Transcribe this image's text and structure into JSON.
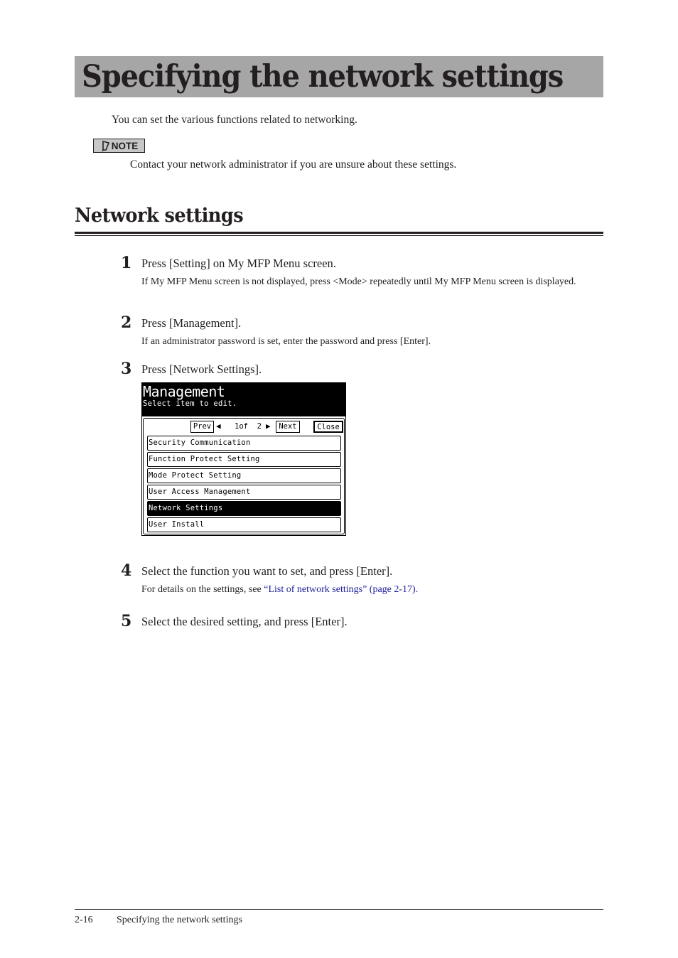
{
  "page_title": "Specifying the network settings",
  "intro": "You can set the various functions related to networking.",
  "note": {
    "icon": "pencil-icon",
    "label": "NOTE",
    "text": "Contact your network administrator if you are unsure about these settings."
  },
  "section": {
    "heading": "Network settings"
  },
  "steps": [
    {
      "number": "1",
      "text": "Press [Setting] on My MFP Menu screen.",
      "sub": "If My MFP Menu screen is not displayed, press <Mode> repeatedly until My MFP Menu screen is displayed."
    },
    {
      "number": "2",
      "text": "Press [Management].",
      "sub": "If an administrator password is set, enter the password and press [Enter]."
    },
    {
      "number": "3",
      "text": "Press [Network Settings]."
    },
    {
      "number": "4",
      "text": "Select the function you want to set, and press [Enter].",
      "sub_prefix": "For details on the settings, see ",
      "sub_link": "“List of network settings” (page 2-17)",
      "sub_suffix": "."
    },
    {
      "number": "5",
      "text": "Select the desired setting, and press [Enter]."
    }
  ],
  "screen": {
    "title": "Management",
    "subtitle": "Select item to edit.",
    "prev_label": "Prev",
    "next_label": "Next",
    "close_label": "Close",
    "page_current": "1",
    "page_of": "of",
    "page_total": "2",
    "items": [
      {
        "label": "Security Communication",
        "selected": false
      },
      {
        "label": "Function Protect Setting",
        "selected": false
      },
      {
        "label": "Mode Protect Setting",
        "selected": false
      },
      {
        "label": "User Access Management",
        "selected": false
      },
      {
        "label": "Network Settings",
        "selected": true
      },
      {
        "label": "User Install",
        "selected": false
      }
    ]
  },
  "footer": {
    "page_number": "2-16",
    "chapter_title": "Specifying the network settings"
  },
  "colors": {
    "title_bar": "#a7a6a6",
    "link": "#1d1d9b",
    "text": "#231f20"
  }
}
